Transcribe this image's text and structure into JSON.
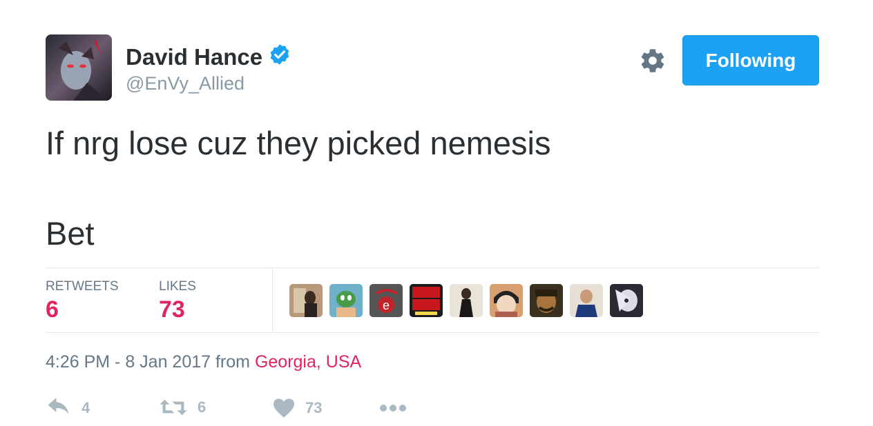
{
  "author": {
    "name": "David Hance",
    "handle": "@EnVy_Allied",
    "verified_icon": "verified-badge-icon"
  },
  "header": {
    "settings_icon": "gear-icon",
    "follow_button_label": "Following"
  },
  "tweet": {
    "lines": [
      "If nrg lose cuz they picked nemesis",
      "Bet"
    ]
  },
  "stats": {
    "retweets_label": "RETWEETS",
    "retweets_value": "6",
    "likes_label": "LIKES",
    "likes_value": "73"
  },
  "likers": [
    "avatar",
    "avatar",
    "avatar",
    "avatar",
    "avatar",
    "avatar",
    "avatar",
    "avatar",
    "avatar"
  ],
  "meta": {
    "time_prefix": "4:26 PM - 8 Jan 2017 from ",
    "location": "Georgia, USA"
  },
  "actions": {
    "reply_count": "4",
    "retweet_count": "6",
    "like_count": "73",
    "more_icon": "more-icon"
  },
  "colors": {
    "brand_blue": "#1da1f2",
    "like_red": "#e0245e",
    "muted": "#657786",
    "action_gray": "#aab8c2"
  }
}
